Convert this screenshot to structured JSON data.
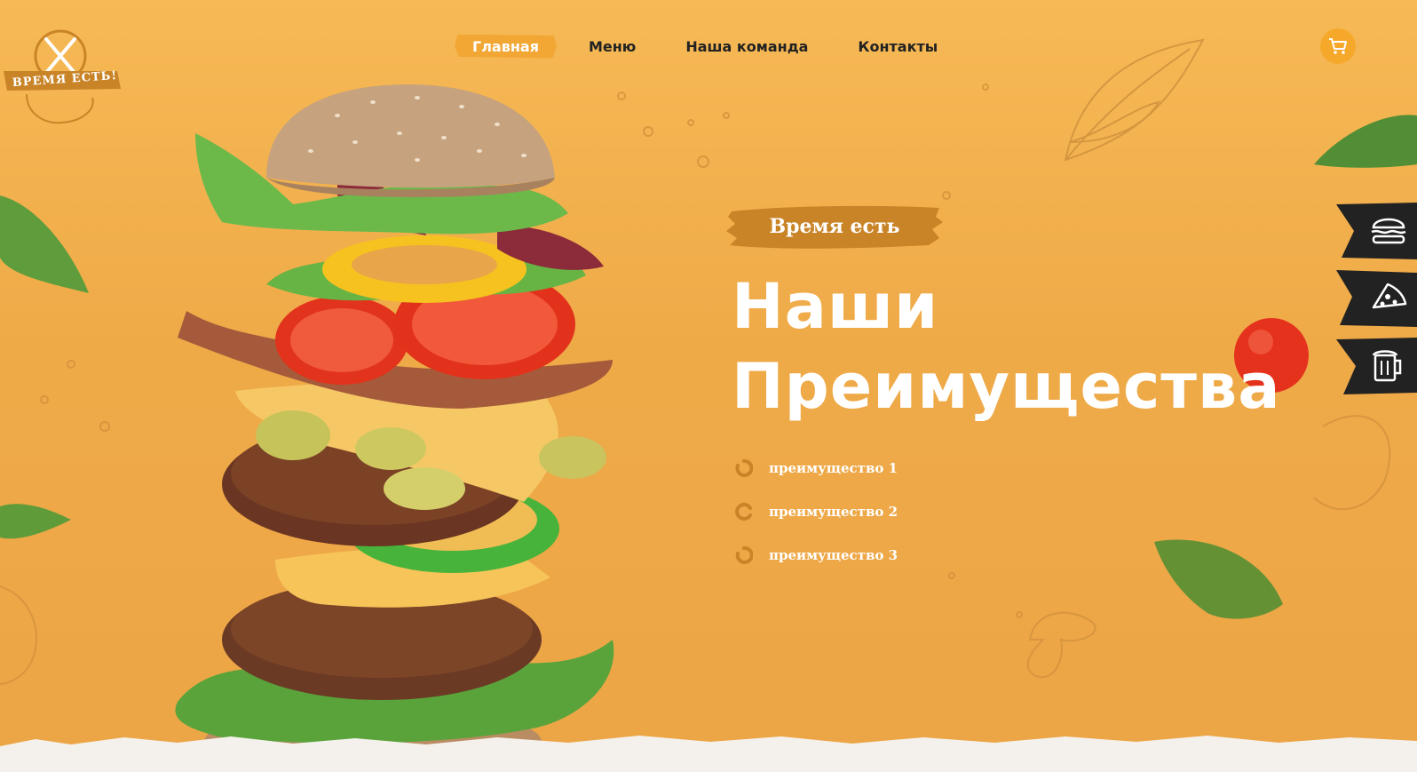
{
  "brand": {
    "logo_text": "ВРЕМЯ ЕСТЬ!"
  },
  "nav": {
    "items": [
      {
        "label": "Главная",
        "active": true
      },
      {
        "label": "Меню",
        "active": false
      },
      {
        "label": "Наша команда",
        "active": false
      },
      {
        "label": "Контакты",
        "active": false
      }
    ]
  },
  "header": {
    "cart_icon": "cart-icon"
  },
  "hero": {
    "tag": "Время есть",
    "title_line1": "Наши",
    "title_line2": "Преимущества",
    "features": [
      "преимущество 1",
      "преимущество 2",
      "преимущество 3"
    ]
  },
  "side_menu": [
    {
      "icon": "burger-icon"
    },
    {
      "icon": "pizza-icon"
    },
    {
      "icon": "beer-icon"
    }
  ],
  "colors": {
    "background_top": "#f6b955",
    "background_bottom": "#eca546",
    "accent": "#f2a734",
    "tag_brush": "#c98428",
    "side_flag": "#222222",
    "text_dark": "#222222",
    "text_light": "#ffffff"
  }
}
